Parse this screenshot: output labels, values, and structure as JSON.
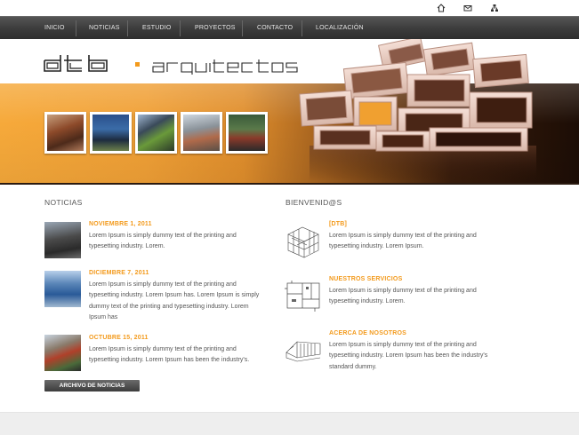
{
  "utility_icons": [
    "home-icon",
    "mail-icon",
    "sitemap-icon"
  ],
  "nav": {
    "items": [
      "INICIO",
      "NOTICIAS",
      "ESTUDIO",
      "PROYECTOS",
      "CONTACTO",
      "LOCALIZACIÓN"
    ]
  },
  "brand": {
    "logo_word": "dtb",
    "logo_suffix": "arquitectos",
    "accent_color": "#f39a1c"
  },
  "hero": {
    "thumbnails": [
      "building-photo-1",
      "building-photo-2",
      "building-photo-3",
      "building-photo-4",
      "building-photo-5"
    ]
  },
  "news": {
    "title": "NOTICIAS",
    "items": [
      {
        "date": "NOVIEMBRE 1, 2011",
        "text": "Lorem Ipsum is simply dummy text of the printing and typesetting industry. Lorem."
      },
      {
        "date": "DICIEMBRE 7, 2011",
        "text": "Lorem Ipsum is simply dummy text of the printing and typesetting industry. Lorem Ipsum has. Lorem Ipsum is simply dummy text of the printing and typesetting industry. Lorem Ipsum has"
      },
      {
        "date": "OCTUBRE 15, 2011",
        "text": "Lorem Ipsum is simply dummy text of the printing and typesetting industry. Lorem Ipsum has been the industry's."
      }
    ],
    "archive_label": "ARCHIVO DE NOTICIAS"
  },
  "welcome": {
    "title": "BIENVENID@S",
    "items": [
      {
        "heading": "[DTB]",
        "text": "Lorem Ipsum is simply dummy text of the printing and typesetting industry. Lorem Ipsum."
      },
      {
        "heading": "NUESTROS SERVICIOS",
        "text": "Lorem Ipsum is simply dummy text of the printing and typesetting industry. Lorem."
      },
      {
        "heading": "ACERCA DE NOSOTROS",
        "text": "Lorem Ipsum is simply dummy text of the printing and typesetting industry. Lorem Ipsum has been the industry's standard dummy."
      }
    ]
  }
}
